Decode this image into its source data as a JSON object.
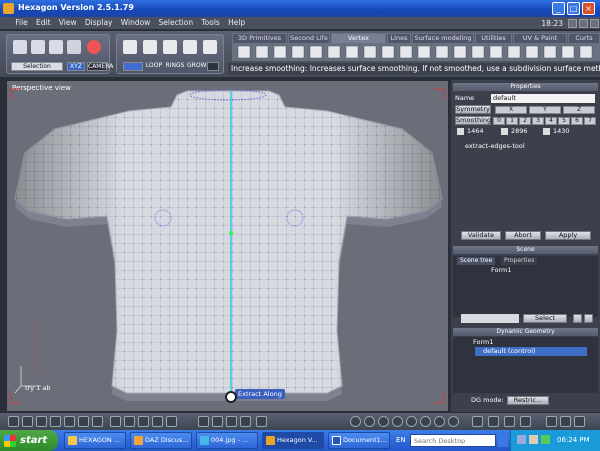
{
  "window": {
    "title": "Hexagon Version 2.5.1.79"
  },
  "menu": [
    "File",
    "Edit",
    "View",
    "Display",
    "Window",
    "Selection",
    "Tools",
    "Help"
  ],
  "clock_menu": "18:23",
  "toolbar": {
    "selection_label": "Selection",
    "xyz_label": "XYZ",
    "camera_label": "CAMERA",
    "loop_label": "LOOP",
    "rings_label": "RINGS",
    "grow_label": "GROW"
  },
  "tabs": [
    "3D Primitives",
    "Second Life",
    "Vertex modeling",
    "Lines",
    "Surface modeling",
    "Utilities",
    "UV & Paint",
    "Curts"
  ],
  "active_tab": "Vertex modeling",
  "hint": "Increase smoothing: Increases surface smoothing. If not smoothed, use a subdivision surface method (link",
  "viewport": {
    "title": "Perspective view",
    "axis_label": "try 1 ab",
    "tool_tooltip": "Extract Along"
  },
  "properties": {
    "header": "Properties",
    "name_label": "Name",
    "name_value": "default",
    "symmetry_label": "Symmetry",
    "axes": [
      "X",
      "Y",
      "Z"
    ],
    "smoothing_label": "Smoothing",
    "smoothing_levels": [
      "0",
      "1",
      "2",
      "3",
      "4",
      "5",
      "6",
      "7"
    ],
    "counts": [
      "1464",
      "2896",
      "1430"
    ],
    "tool_name": "extract-edges-tool",
    "validate": "Validate",
    "abort": "Abort",
    "apply": "Apply"
  },
  "scene": {
    "header": "Scene",
    "tab_tree": "Scene tree",
    "tab_props": "Properties",
    "item": "Form1",
    "select": "Select"
  },
  "dynamic_geometry": {
    "header": "Dynamic Geometry",
    "form": "Form1",
    "child": "default (control)",
    "dg_mode_label": "DG mode:",
    "dg_mode_value": "Restric..."
  },
  "taskbar": {
    "start": "start",
    "tasks": [
      "HEXAGON ...",
      "DAZ Discus...",
      "004.jpg - ...",
      "Hexagon V...",
      "Document1..."
    ],
    "lang": "EN",
    "search_placeholder": "Search Desktop",
    "time": "06:24 PM"
  },
  "colors": {
    "axis_line": "#26c6f0",
    "selection_green": "#22ff44",
    "title_blue": "#1747b8"
  }
}
